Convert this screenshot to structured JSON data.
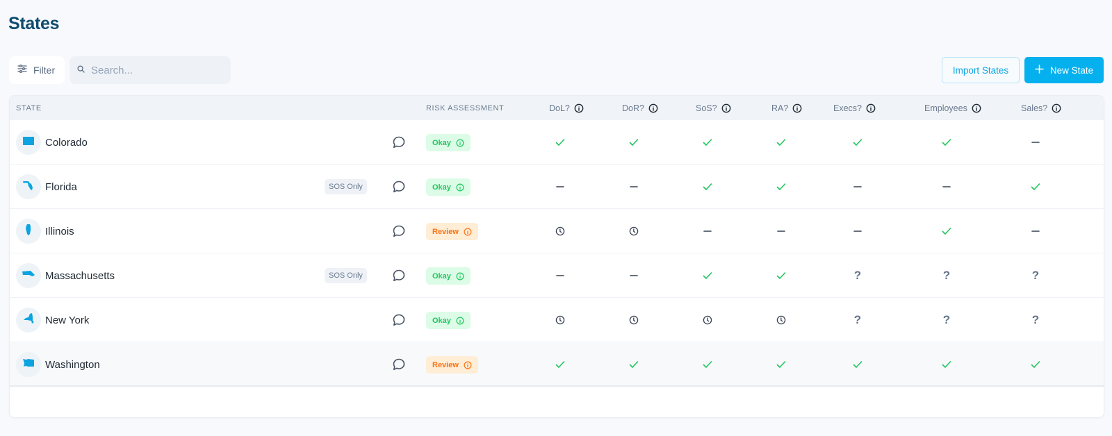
{
  "page": {
    "title": "States"
  },
  "toolbar": {
    "filter_label": "Filter",
    "search_placeholder": "Search...",
    "search_value": "",
    "import_label": "Import States",
    "new_label": "New State"
  },
  "colors": {
    "accent": "#04b0ee",
    "title": "#0f4c6e",
    "check": "#22c55e",
    "okay_bg": "#dcfce7",
    "okay_fg": "#22c55e",
    "review_bg": "#ffedd5",
    "review_fg": "#f97316",
    "state_icon": "#0ba4e0"
  },
  "table": {
    "headers": {
      "state": "State",
      "risk": "Risk Assessment",
      "dol": "DoL?",
      "dor": "DoR?",
      "sos": "SoS?",
      "ra": "RA?",
      "execs": "Execs?",
      "employees": "Employees",
      "sales": "Sales?"
    },
    "status_legend": {
      "check": "yes",
      "dash": "no",
      "clock": "pending",
      "question": "unknown"
    },
    "rows": [
      {
        "name": "Colorado",
        "icon": "colorado-shape",
        "badge": "",
        "risk": "Okay",
        "risk_type": "okay",
        "dol": "check",
        "dor": "check",
        "sos": "check",
        "ra": "check",
        "execs": "check",
        "employees": "check",
        "sales": "dash"
      },
      {
        "name": "Florida",
        "icon": "florida-shape",
        "badge": "SOS Only",
        "risk": "Okay",
        "risk_type": "okay",
        "dol": "dash",
        "dor": "dash",
        "sos": "check",
        "ra": "check",
        "execs": "dash",
        "employees": "dash",
        "sales": "check"
      },
      {
        "name": "Illinois",
        "icon": "illinois-shape",
        "badge": "",
        "risk": "Review",
        "risk_type": "review",
        "dol": "clock",
        "dor": "clock",
        "sos": "dash",
        "ra": "dash",
        "execs": "dash",
        "employees": "check",
        "sales": "dash"
      },
      {
        "name": "Massachusetts",
        "icon": "massachusetts-shape",
        "badge": "SOS Only",
        "risk": "Okay",
        "risk_type": "okay",
        "dol": "dash",
        "dor": "dash",
        "sos": "check",
        "ra": "check",
        "execs": "question",
        "employees": "question",
        "sales": "question"
      },
      {
        "name": "New York",
        "icon": "new-york-shape",
        "badge": "",
        "risk": "Okay",
        "risk_type": "okay",
        "dol": "clock",
        "dor": "clock",
        "sos": "clock",
        "ra": "clock",
        "execs": "question",
        "employees": "question",
        "sales": "question"
      },
      {
        "name": "Washington",
        "icon": "washington-shape",
        "badge": "",
        "risk": "Review",
        "risk_type": "review",
        "dol": "check",
        "dor": "check",
        "sos": "check",
        "ra": "check",
        "execs": "check",
        "employees": "check",
        "sales": "check"
      }
    ]
  }
}
